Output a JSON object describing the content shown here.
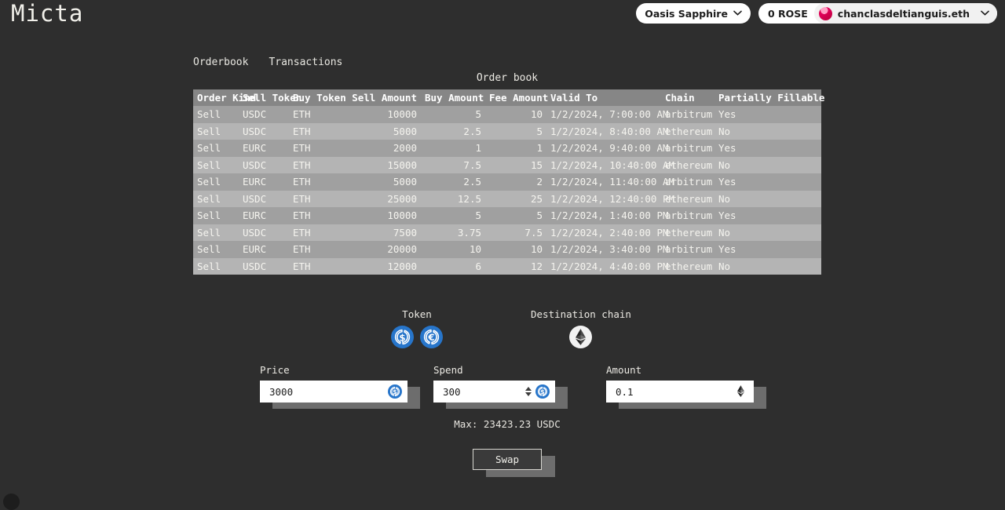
{
  "app": {
    "logo": "Micta"
  },
  "header": {
    "network": {
      "label": "Oasis Sapphire",
      "chevron": "⌄"
    },
    "account": {
      "balance": "0 ROSE",
      "name": "chanclasdeltianguis.eth",
      "chevron": "⌄",
      "avatar_color": "#d9003f"
    }
  },
  "tabs": [
    {
      "label": "Orderbook",
      "active": true
    },
    {
      "label": "Transactions",
      "active": false
    }
  ],
  "orderbook": {
    "title": "Order book",
    "columns": [
      "Order Kind",
      "Sell Token",
      "Buy Token",
      "Sell Amount",
      "Buy Amount",
      "Fee Amount",
      "Valid To",
      "Chain",
      "Partially Fillable"
    ],
    "rows": [
      {
        "order_kind": "Sell",
        "sell_token": "USDC",
        "buy_token": "ETH",
        "sell_amount": "10000",
        "buy_amount": "5",
        "fee_amount": "10",
        "valid_to": "1/2/2024, 7:00:00 AM",
        "chain": "arbitrum",
        "partially_fillable": "Yes"
      },
      {
        "order_kind": "Sell",
        "sell_token": "USDC",
        "buy_token": "ETH",
        "sell_amount": "5000",
        "buy_amount": "2.5",
        "fee_amount": "5",
        "valid_to": "1/2/2024, 8:40:00 AM",
        "chain": "ethereum",
        "partially_fillable": "No"
      },
      {
        "order_kind": "Sell",
        "sell_token": "EURC",
        "buy_token": "ETH",
        "sell_amount": "2000",
        "buy_amount": "1",
        "fee_amount": "1",
        "valid_to": "1/2/2024, 9:40:00 AM",
        "chain": "arbitrum",
        "partially_fillable": "Yes"
      },
      {
        "order_kind": "Sell",
        "sell_token": "USDC",
        "buy_token": "ETH",
        "sell_amount": "15000",
        "buy_amount": "7.5",
        "fee_amount": "15",
        "valid_to": "1/2/2024, 10:40:00 AM",
        "chain": "ethereum",
        "partially_fillable": "No"
      },
      {
        "order_kind": "Sell",
        "sell_token": "EURC",
        "buy_token": "ETH",
        "sell_amount": "5000",
        "buy_amount": "2.5",
        "fee_amount": "2",
        "valid_to": "1/2/2024, 11:40:00 AM",
        "chain": "arbitrum",
        "partially_fillable": "Yes"
      },
      {
        "order_kind": "Sell",
        "sell_token": "USDC",
        "buy_token": "ETH",
        "sell_amount": "25000",
        "buy_amount": "12.5",
        "fee_amount": "25",
        "valid_to": "1/2/2024, 12:40:00 PM",
        "chain": "ethereum",
        "partially_fillable": "No"
      },
      {
        "order_kind": "Sell",
        "sell_token": "EURC",
        "buy_token": "ETH",
        "sell_amount": "10000",
        "buy_amount": "5",
        "fee_amount": "5",
        "valid_to": "1/2/2024, 1:40:00 PM",
        "chain": "arbitrum",
        "partially_fillable": "Yes"
      },
      {
        "order_kind": "Sell",
        "sell_token": "USDC",
        "buy_token": "ETH",
        "sell_amount": "7500",
        "buy_amount": "3.75",
        "fee_amount": "7.5",
        "valid_to": "1/2/2024, 2:40:00 PM",
        "chain": "ethereum",
        "partially_fillable": "No"
      },
      {
        "order_kind": "Sell",
        "sell_token": "EURC",
        "buy_token": "ETH",
        "sell_amount": "20000",
        "buy_amount": "10",
        "fee_amount": "10",
        "valid_to": "1/2/2024, 3:40:00 PM",
        "chain": "arbitrum",
        "partially_fillable": "Yes"
      },
      {
        "order_kind": "Sell",
        "sell_token": "USDC",
        "buy_token": "ETH",
        "sell_amount": "12000",
        "buy_amount": "6",
        "fee_amount": "12",
        "valid_to": "1/2/2024, 4:40:00 PM",
        "chain": "ethereum",
        "partially_fillable": "No"
      }
    ]
  },
  "selectors": {
    "token": {
      "label": "Token",
      "options": [
        {
          "name": "usdc-coin-icon",
          "symbol": "$",
          "color": "#2775ca",
          "selected": true
        },
        {
          "name": "eurc-coin-icon",
          "symbol": "€",
          "color": "#2775ca",
          "selected": false
        }
      ]
    },
    "destination_chain": {
      "label": "Destination chain",
      "options": [
        {
          "name": "ethereum-chain-icon",
          "selected": true
        }
      ]
    }
  },
  "form": {
    "price": {
      "label": "Price",
      "value": "3000",
      "placeholder": "",
      "icon": "usdc-coin-icon"
    },
    "spend": {
      "label": "Spend",
      "value": "300",
      "placeholder": "",
      "icon": "usdc-coin-icon",
      "has_spinner": true
    },
    "amount": {
      "label": "Amount",
      "value": "0.1",
      "placeholder": "",
      "icon": "eth-icon"
    },
    "max_text": "Max: 23423.23 USDC",
    "submit_label": "Swap"
  },
  "colors": {
    "background": "#2e2e2e",
    "table_header": "#868686",
    "row_odd": "#a0a0a0",
    "row_even": "#b4b4b4",
    "coin_blue": "#2775ca"
  }
}
